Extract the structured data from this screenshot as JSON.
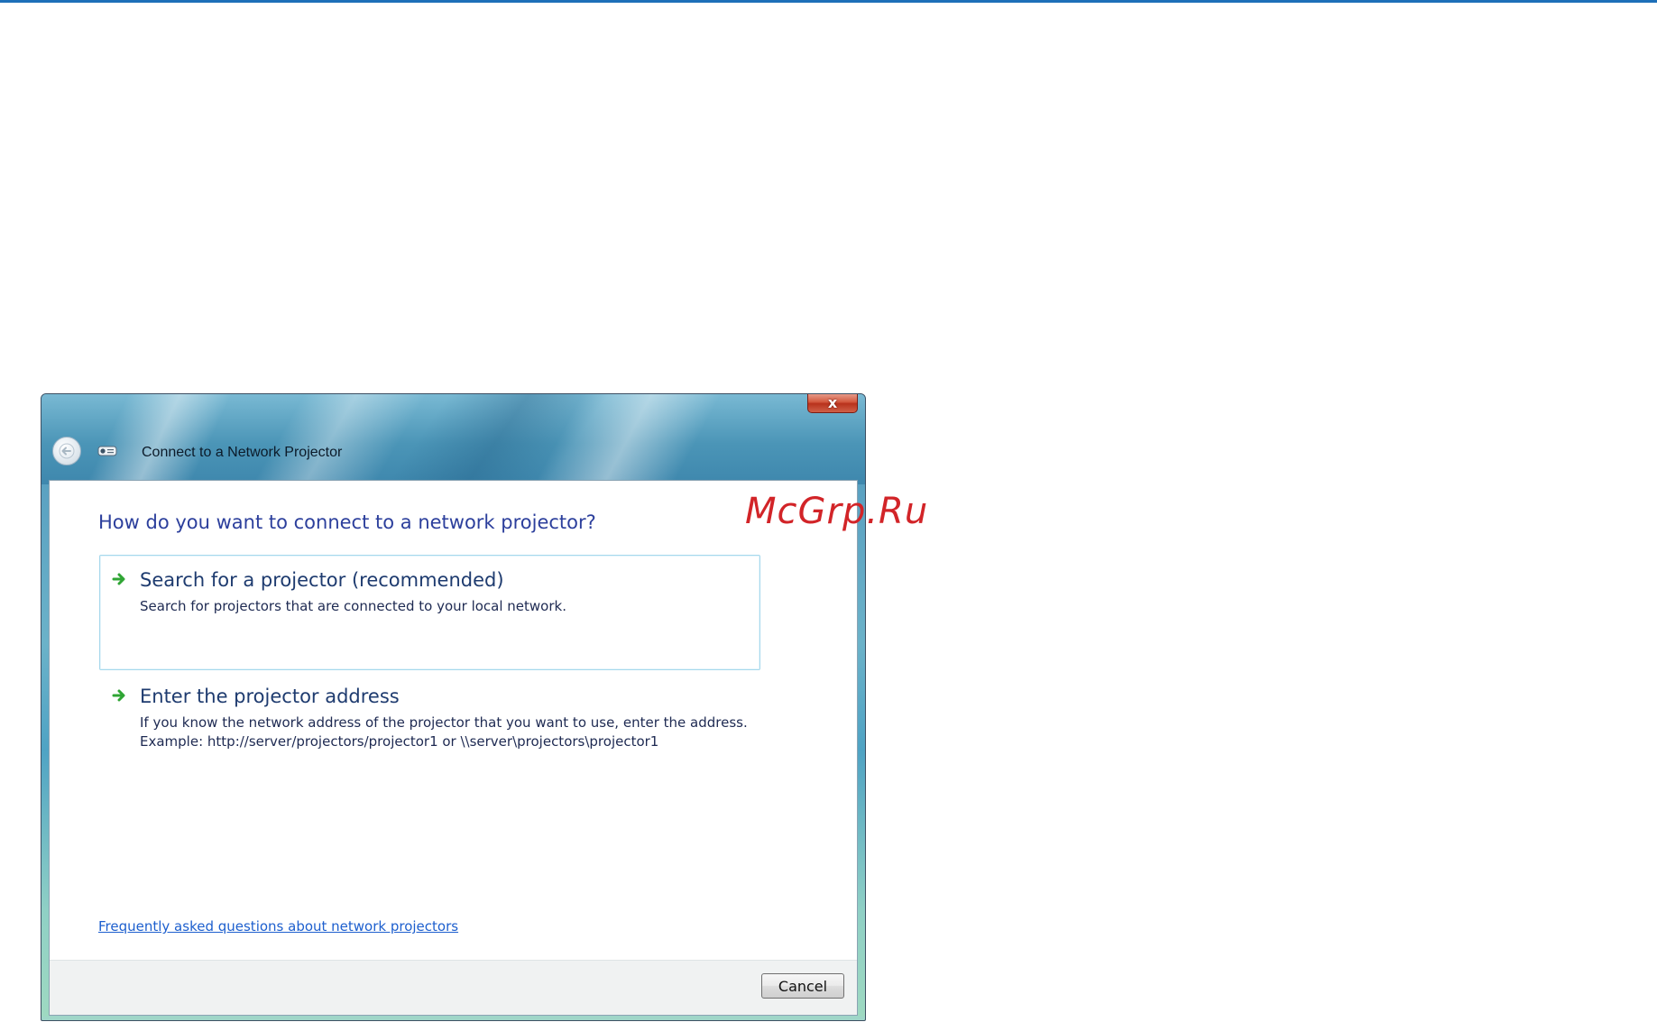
{
  "window": {
    "title": "Connect to a Network Projector",
    "close_label": "x"
  },
  "main": {
    "heading": "How do you want to connect to a network projector?",
    "options": [
      {
        "title": "Search for a projector (recommended)",
        "description_lines": [
          "Search for projectors that are connected to your local network."
        ],
        "icon": "green-arrow-icon",
        "selected": true
      },
      {
        "title": "Enter the projector address",
        "description_lines": [
          "If you know the network address of the projector that you want to use, enter the address.",
          "Example: http://server/projectors/projector1 or \\\\server\\projectors\\projector1"
        ],
        "icon": "green-arrow-icon",
        "selected": false
      }
    ],
    "faq_link": "Frequently asked questions about network projectors"
  },
  "footer": {
    "cancel_label": "Cancel"
  },
  "watermark": "McGrp.Ru",
  "colors": {
    "heading": "#2c3f9c",
    "link": "#1d5fce",
    "selection_border": "#a6d8ec",
    "top_rule": "#1d6fb8",
    "watermark": "#d22428"
  }
}
